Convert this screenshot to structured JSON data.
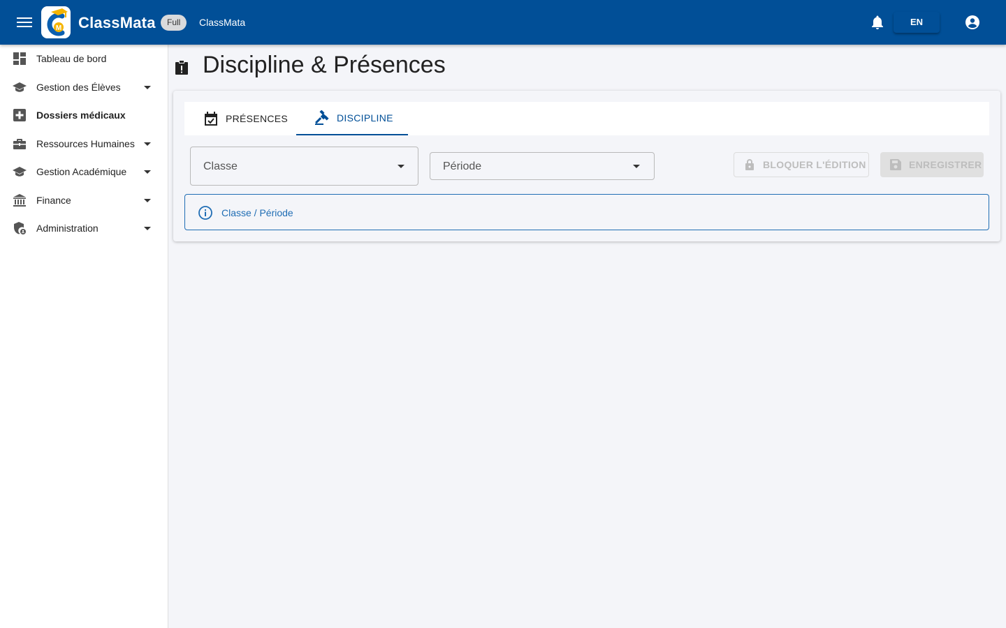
{
  "header": {
    "brand": "ClassMata",
    "plan_badge": "Full",
    "subtitle": "ClassMata",
    "language": "EN",
    "logo_letters": "CM",
    "colors": {
      "bar": "#014f97",
      "logo_accent": "#f5b400"
    }
  },
  "sidebar": {
    "items": [
      {
        "label": "Tableau de bord",
        "icon": "dashboard-icon",
        "expandable": false
      },
      {
        "label": "Gestion des Élèves",
        "icon": "school-icon",
        "expandable": true
      },
      {
        "label": "Dossiers médicaux",
        "icon": "medical-icon",
        "expandable": false,
        "active": true
      },
      {
        "label": "Ressources Humaines",
        "icon": "briefcase-icon",
        "expandable": true
      },
      {
        "label": "Gestion Académique",
        "icon": "school-icon",
        "expandable": true
      },
      {
        "label": "Finance",
        "icon": "bank-icon",
        "expandable": true
      },
      {
        "label": "Administration",
        "icon": "admin-shield-icon",
        "expandable": true
      }
    ]
  },
  "page": {
    "title": "Discipline & Présences",
    "icon": "clipboard-alert-icon"
  },
  "tabs": [
    {
      "label": "PRÉSENCES",
      "icon": "calendar-check-icon",
      "active": false
    },
    {
      "label": "DISCIPLINE",
      "icon": "gavel-icon",
      "active": true
    }
  ],
  "filters": {
    "classe_label": "Classe",
    "periode_label": "Période"
  },
  "actions": {
    "lock_label": "BLOQUER L'ÉDITION",
    "save_label": "ENREGISTRER"
  },
  "info": {
    "message": "Classe / Période"
  }
}
